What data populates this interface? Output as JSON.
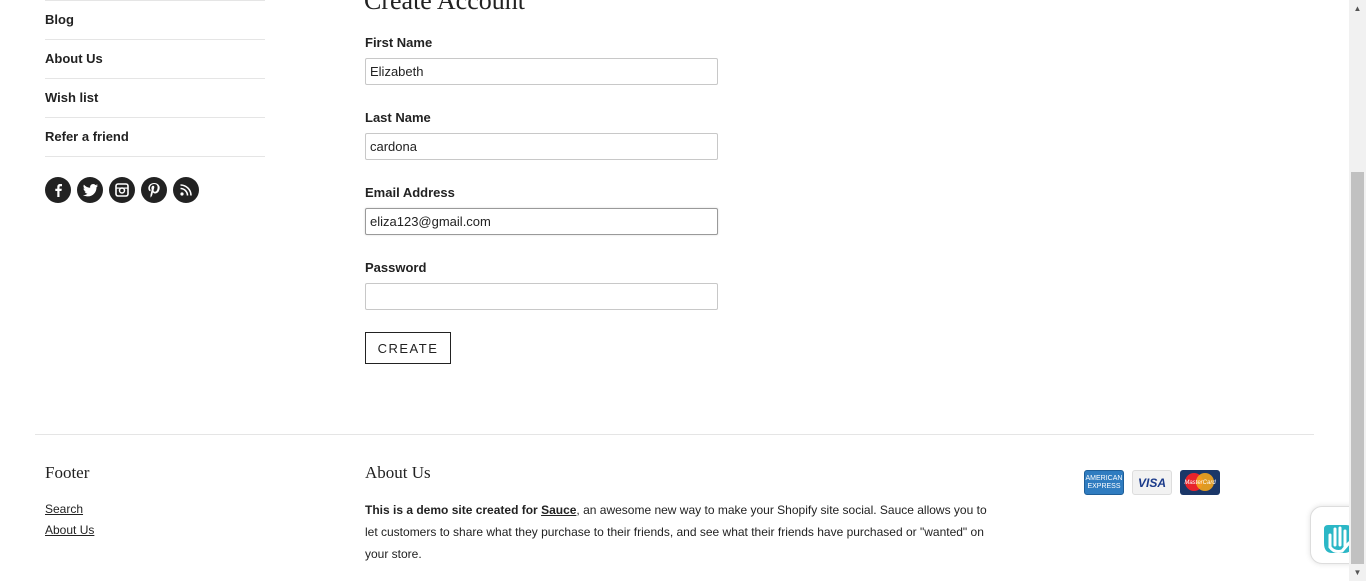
{
  "sidebar": {
    "items": [
      {
        "label": "Blog"
      },
      {
        "label": "About Us"
      },
      {
        "label": "Wish list"
      },
      {
        "label": "Refer a friend"
      }
    ],
    "social": [
      "facebook-icon",
      "twitter-icon",
      "instagram-icon",
      "pinterest-icon",
      "rss-icon"
    ]
  },
  "form": {
    "title": "Create Account",
    "first_name": {
      "label": "First Name",
      "value": "Elizabeth"
    },
    "last_name": {
      "label": "Last Name",
      "value": "cardona"
    },
    "email": {
      "label": "Email Address",
      "value": "eliza123@gmail.com"
    },
    "password": {
      "label": "Password",
      "value": ""
    },
    "submit_label": "CREATE"
  },
  "footer": {
    "heading": "Footer",
    "links": [
      {
        "label": "Search"
      },
      {
        "label": "About Us"
      }
    ],
    "about": {
      "heading": "About Us",
      "intro": "This is a demo site created for ",
      "link": "Sauce",
      "rest": ", an awesome new way to make your Shopify site social. Sauce allows you to let customers to share what they purchase to their friends, and see what their friends have purchased or \"wanted\" on your store."
    },
    "payment_icons": [
      "amex-icon",
      "visa-icon",
      "mastercard-icon"
    ],
    "cards": {
      "amex": "AMERICAN EXPRESS",
      "visa": "VISA",
      "mastercard": "MasterCard"
    }
  },
  "colors": {
    "text": "#222222",
    "border": "#c8c8c8",
    "scroll_thumb": "#c1c1c1"
  }
}
